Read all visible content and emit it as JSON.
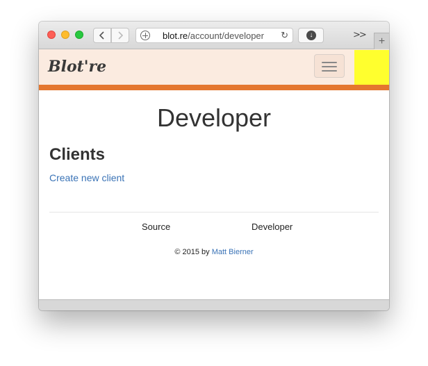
{
  "browser": {
    "url_host": "blot.re",
    "url_path": "/account/developer",
    "overflow_label": ">>",
    "new_tab_label": "+",
    "reload_glyph": "↻",
    "download_glyph": "↓"
  },
  "header": {
    "logo_text": "Blot're",
    "accent_color": "#e4772f",
    "header_bg": "#fbebe0",
    "yellow_block_color": "#ffff2e"
  },
  "main": {
    "title": "Developer",
    "section_heading": "Clients",
    "create_link": "Create new client"
  },
  "footer": {
    "links": [
      "Source",
      "Developer"
    ],
    "copyright_prefix": "© 2015 by",
    "author": "Matt Bierner"
  }
}
